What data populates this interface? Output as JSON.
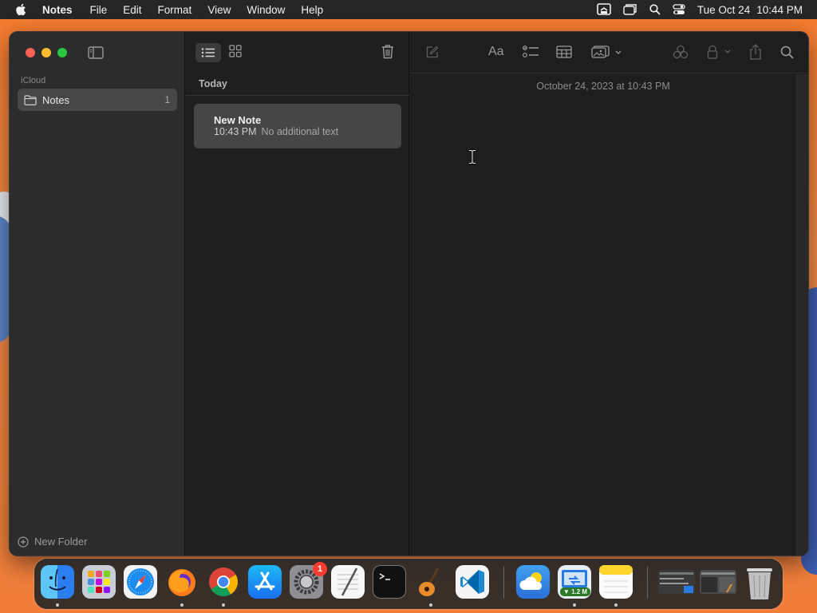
{
  "menubar": {
    "app_name": "Notes",
    "menus": [
      "File",
      "Edit",
      "Format",
      "View",
      "Window",
      "Help"
    ],
    "status_icons": [
      "screen-mirroring-icon",
      "stage-manager-icon",
      "spotlight-search-icon",
      "control-center-icon"
    ],
    "date": "Tue Oct 24",
    "time": "10:44 PM"
  },
  "sidebar": {
    "section_label": "iCloud",
    "folders": [
      {
        "label": "Notes",
        "count": "1",
        "selected": true
      }
    ],
    "new_folder_label": "New Folder"
  },
  "note_list": {
    "view_modes": [
      "list-view-icon",
      "gallery-view-icon"
    ],
    "section_header": "Today",
    "notes": [
      {
        "title": "New Note",
        "time": "10:43 PM",
        "preview": "No additional text"
      }
    ]
  },
  "editor": {
    "toolbar_icons": [
      "compose-icon",
      "format-text-icon",
      "checklist-icon",
      "table-icon",
      "media-icon",
      "collaborate-icon",
      "lock-icon",
      "share-icon",
      "search-icon"
    ],
    "format_label": "Aa",
    "date_header": "October 24, 2023 at 10:43 PM"
  },
  "dock": {
    "apps": [
      "Finder",
      "Launchpad",
      "Safari",
      "Firefox",
      "Google Chrome",
      "App Store",
      "System Settings",
      "TextEdit",
      "Terminal",
      "GarageBand",
      "Visual Studio Code",
      "Weather",
      "Screen Sharing Download",
      "Notes",
      "Recent Window 1",
      "Recent Window 2",
      "Trash"
    ],
    "system_settings_badge": "1",
    "download_progress_label": "▼ 1.2 M"
  },
  "colors": {
    "accent_red": "#fe5f57",
    "accent_yellow": "#febc2e",
    "accent_green": "#28c840",
    "window_bg": "#1e1e1e",
    "selection_bg": "#464646"
  }
}
